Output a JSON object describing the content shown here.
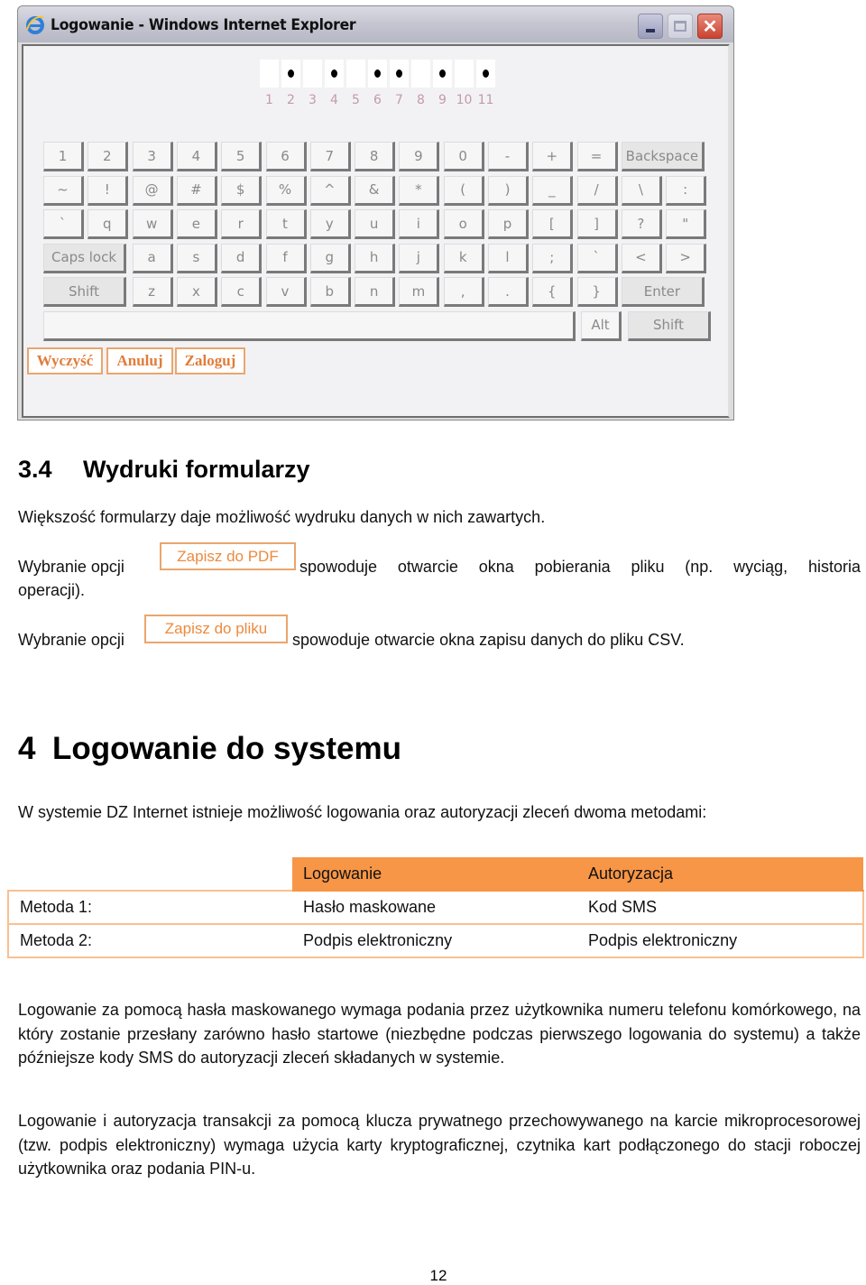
{
  "window": {
    "title": "Logowanie - Windows Internet Explorer",
    "icon": "ie-logo-icon",
    "controls": [
      "minimize-icon",
      "maximize-icon",
      "close-icon"
    ]
  },
  "password": {
    "positions": [
      "1",
      "2",
      "3",
      "4",
      "5",
      "6",
      "7",
      "8",
      "9",
      "10",
      "11"
    ],
    "filled": [
      false,
      true,
      false,
      true,
      false,
      true,
      true,
      false,
      true,
      false,
      true
    ]
  },
  "keyboard": {
    "rows": [
      [
        "1",
        "2",
        "3",
        "4",
        "5",
        "6",
        "7",
        "8",
        "9",
        "0",
        "-",
        "+",
        "=",
        "Backspace"
      ],
      [
        "~",
        "!",
        "@",
        "#",
        "$",
        "%",
        "^",
        "&",
        "*",
        "(",
        ")",
        "_",
        "/",
        "\\",
        ":"
      ],
      [
        "`",
        "q",
        "w",
        "e",
        "r",
        "t",
        "y",
        "u",
        "i",
        "o",
        "p",
        "[",
        "]",
        "?",
        "\""
      ],
      [
        "Caps lock",
        "a",
        "s",
        "d",
        "f",
        "g",
        "h",
        "j",
        "k",
        "l",
        ";",
        "`",
        "<",
        ">"
      ],
      [
        "Shift",
        "z",
        "x",
        "c",
        "v",
        "b",
        "n",
        "m",
        ",",
        ".",
        "{",
        "}",
        "Enter"
      ],
      [
        "",
        "Alt",
        "Shift"
      ]
    ]
  },
  "form_buttons": {
    "clear": "Wyczyść",
    "cancel": "Anuluj",
    "login": "Zaloguj"
  },
  "section_3_4": {
    "number": "3.4",
    "title": "Wydruki formularzy",
    "intro": "Większość formularzy daje możliwość wydruku danych w nich zawartych.",
    "pdf_prefix": "Wybranie opcji",
    "pdf_button": "Zapisz do PDF",
    "pdf_suffix": "spowoduje otwarcie okna pobierania pliku (np. wyciąg, historia",
    "pdf_suffix_cont": "operacji).",
    "file_prefix": "Wybranie opcji",
    "file_button": "Zapisz do pliku",
    "file_suffix": "spowoduje otwarcie okna zapisu danych do pliku CSV."
  },
  "section_4": {
    "number": "4",
    "title": "Logowanie do systemu",
    "intro": "W systemie DZ Internet istnieje możliwość logowania oraz autoryzacji zleceń  dwoma metodami:",
    "table": {
      "headers": [
        "",
        "Logowanie",
        "Autoryzacja"
      ],
      "rows": [
        [
          "Metoda 1:",
          "Hasło maskowane",
          "Kod SMS"
        ],
        [
          "Metoda 2:",
          "Podpis elektroniczny",
          "Podpis elektroniczny"
        ]
      ]
    },
    "para1": "Logowanie za pomocą hasła maskowanego wymaga podania przez użytkownika numeru telefonu komórkowego, na który zostanie przesłany zarówno hasło startowe (niezbędne podczas pierwszego logowania do systemu) a także późniejsze kody SMS do autoryzacji zleceń składanych w systemie.",
    "para2": "Logowanie i autoryzacja transakcji za pomocą klucza prywatnego przechowywanego na karcie mikroprocesorowej (tzw. podpis elektroniczny) wymaga użycia karty kryptograficznej, czytnika kart podłączonego do stacji roboczej użytkownika oraz podania PIN-u."
  },
  "page_number": "12",
  "colors": {
    "accent": "#f79646",
    "button_text": "#e07d3a",
    "table_border": "#f9c090"
  }
}
